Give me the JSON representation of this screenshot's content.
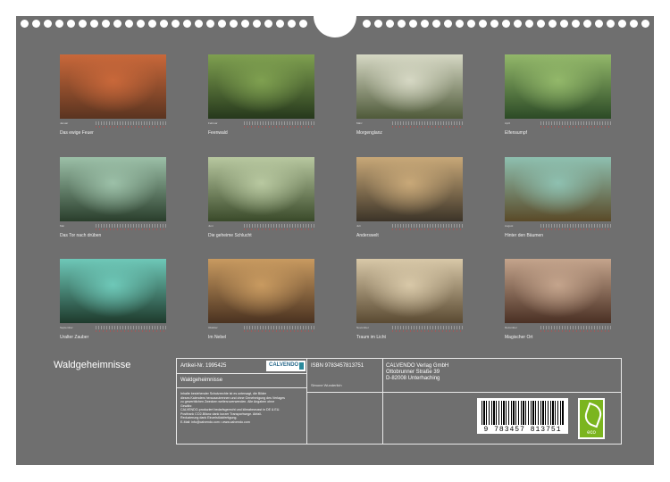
{
  "months": [
    {
      "label": "Januar",
      "title": "Das ewige Feuer",
      "c1": "#c9683a",
      "c2": "#5a3420"
    },
    {
      "label": "Februar",
      "title": "Feenwald",
      "c1": "#7fa050",
      "c2": "#26381c"
    },
    {
      "label": "März",
      "title": "Morgenglanz",
      "c1": "#d6d8c4",
      "c2": "#4f5a3a"
    },
    {
      "label": "April",
      "title": "Elfensumpf",
      "c1": "#93b86a",
      "c2": "#2c4a26"
    },
    {
      "label": "Mai",
      "title": "Das Tor nach drüben",
      "c1": "#9cc0a8",
      "c2": "#2a3e2c"
    },
    {
      "label": "Juni",
      "title": "Die geheime Schlucht",
      "c1": "#b8c8a0",
      "c2": "#3a4a2a"
    },
    {
      "label": "Juli",
      "title": "Anderswelt",
      "c1": "#c8a878",
      "c2": "#3c3428"
    },
    {
      "label": "August",
      "title": "Hinter den Bäumen",
      "c1": "#8ec0b0",
      "c2": "#5a4a28"
    },
    {
      "label": "September",
      "title": "Uralter Zauber",
      "c1": "#6ec8b8",
      "c2": "#1e3a2c"
    },
    {
      "label": "Oktober",
      "title": "Im Nebel",
      "c1": "#c89a60",
      "c2": "#4a3220"
    },
    {
      "label": "November",
      "title": "Traum im Licht",
      "c1": "#d8c8a8",
      "c2": "#5a4a32"
    },
    {
      "label": "Dezember",
      "title": "Magischer Ort",
      "c1": "#c4a48c",
      "c2": "#4a3024"
    }
  ],
  "cover_title": "Waldgeheimnisse",
  "info": {
    "article": "Artikel-Nr. 1995425",
    "calvendo_logo": "CALVENDO",
    "product_title": "Waldgeheimnisse",
    "legal_1": "Inhalte bestehender Schutzrechte ist es untersagt, die Bilder",
    "legal_2": "dieses Kalenders herauszutrennen und ohne Genehmigung des Verlages",
    "legal_3": "zu gewerblichen Zwecken weiterzuverwenden. Alle Angaben ohne",
    "legal_4": "Gewähr.",
    "legal_5": "CALVENDO-produziert bedarfsgerecht und klimabewusst in DE & EU.",
    "legal_6": "Postfrank CO2-Bilanz dank kurzer Transportwege. Abfall-",
    "legal_7": "Reduzierung dank Einzelstückfertigung.",
    "legal_8": "E-Mail: info@calvendo.com • www.calvendo.com",
    "isbn": "ISBN 9783457813751",
    "author": "Simone Wunderlich",
    "publisher_1": "CALVENDO Verlag GmbH",
    "publisher_2": "Ottobrunner Straße 39",
    "publisher_3": "D-82008 Unterhaching",
    "barcode_number": "9 783457 813751",
    "eco_label": "eco"
  }
}
